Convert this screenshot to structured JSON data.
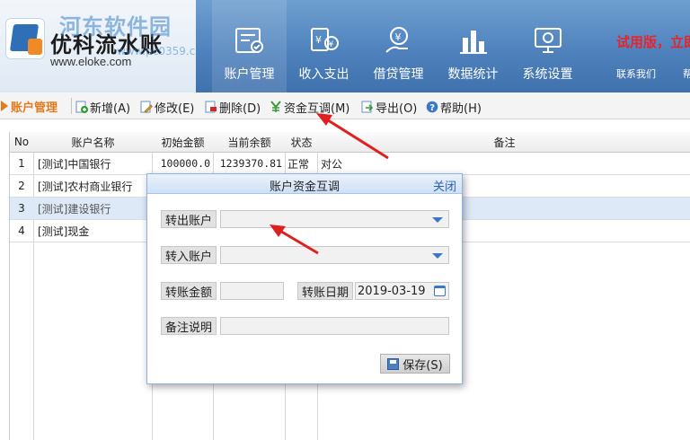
{
  "header": {
    "app_name": "优科流水账",
    "app_url": "www.eloke.com",
    "watermark": "河东软件园",
    "watermark_url": "www.pc0359.cn",
    "trial_text": "试用版，立即",
    "contact": "联系我们",
    "contact2": "帮"
  },
  "nav": [
    {
      "label": "账户管理",
      "icon": "ledger-icon"
    },
    {
      "label": "收入支出",
      "icon": "money-icon"
    },
    {
      "label": "借贷管理",
      "icon": "loan-icon"
    },
    {
      "label": "数据统计",
      "icon": "stats-icon"
    },
    {
      "label": "系统设置",
      "icon": "settings-icon"
    }
  ],
  "toolbar": {
    "module": "账户管理",
    "add": "新增(A)",
    "edit": "修改(E)",
    "delete": "删除(D)",
    "transfer": "资金互调(M)",
    "export": "导出(O)",
    "help": "帮助(H)"
  },
  "table": {
    "headers": [
      "No",
      "账户名称",
      "初始金额",
      "当前余额",
      "状态",
      "备注"
    ],
    "rows": [
      {
        "no": "1",
        "name": "[测试]中国银行",
        "initial": "100000.0",
        "current": "1239370.81",
        "status": "正常",
        "note": "对公"
      },
      {
        "no": "2",
        "name": "[测试]农村商业银行",
        "initial": "",
        "current": "",
        "status": "",
        "note": ""
      },
      {
        "no": "3",
        "name": "[测试]建设银行",
        "initial": "",
        "current": "",
        "status": "",
        "note": ""
      },
      {
        "no": "4",
        "name": "[测试]现金",
        "initial": "",
        "current": "",
        "status": "",
        "note": ""
      }
    ]
  },
  "dialog": {
    "title": "账户资金互调",
    "close": "关闭",
    "from_label": "转出账户",
    "from_value": "",
    "to_label": "转入账户",
    "to_value": "",
    "amount_label": "转账金额",
    "amount_value": "",
    "date_label": "转账日期",
    "date_value": "2019-03-19",
    "note_label": "备注说明",
    "note_value": "",
    "save": "保存(S)"
  },
  "colors": {
    "header_blue": "#4f82bd",
    "accent_orange": "#e47a1c",
    "trial_red": "#e8242b",
    "annotation_red": "#e02020",
    "selected_row": "#dde9f7"
  }
}
